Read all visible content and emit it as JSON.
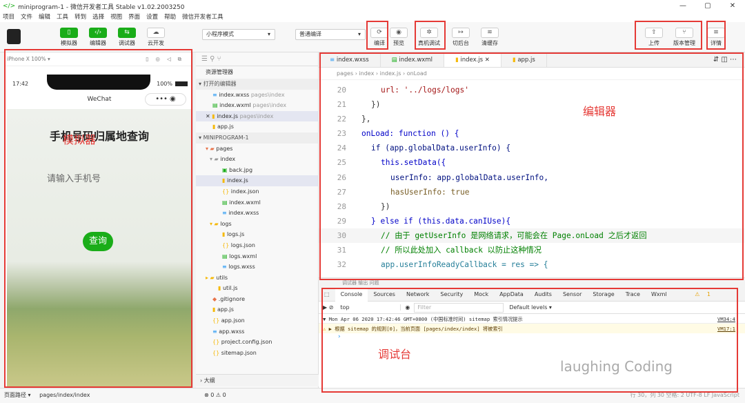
{
  "title": "miniprogram-1 - 微信开发者工具 Stable v1.02.2003250",
  "window_controls": [
    "—",
    "▢",
    "✕"
  ],
  "menu": [
    "项目",
    "文件",
    "编辑",
    "工具",
    "转到",
    "选择",
    "视图",
    "界面",
    "设置",
    "帮助",
    "微信开发者工具"
  ],
  "toolbar": {
    "simulator": "模拟器",
    "editor": "编辑器",
    "debugger": "调试器",
    "cloud": "云开发",
    "mode": "小程序模式",
    "compile_mode": "普通编译",
    "compile": "编译",
    "preview": "预览",
    "real_debug": "真机调试",
    "background": "切后台",
    "clear_cache": "清缓存",
    "upload": "上传",
    "version": "版本管理",
    "details": "详情"
  },
  "annotations": {
    "simulator": "模拟器",
    "editor": "编辑器",
    "debugger": "调试台",
    "watermark": "laughing Coding"
  },
  "sim": {
    "device": "iPhone X 100% ▾",
    "time": "17:42",
    "battery": "100%",
    "nav_title": "WeChat",
    "app_title": "手机号码归属地查询",
    "placeholder": "请输入手机号",
    "button": "查询"
  },
  "explorer": {
    "header": "资源管理器",
    "open_editors": "打开的编辑器",
    "project": "MINIPROGRAM-1",
    "outline": "大纲",
    "open_files": [
      {
        "name": "index.wxss",
        "path": "pages\\index"
      },
      {
        "name": "index.wxml",
        "path": "pages\\index"
      },
      {
        "name": "index.js",
        "path": "pages\\index"
      },
      {
        "name": "app.js",
        "path": ""
      }
    ],
    "tree": [
      "pages",
      "index",
      "back.jpg",
      "index.js",
      "index.json",
      "index.wxml",
      "index.wxss",
      "logs",
      "logs.js",
      "logs.json",
      "logs.wxml",
      "logs.wxss",
      "utils",
      "util.js",
      ".gitignore",
      "app.js",
      "app.json",
      "app.wxss",
      "project.config.json",
      "sitemap.json"
    ]
  },
  "editor": {
    "tabs": [
      "index.wxss",
      "index.wxml",
      "index.js",
      "app.js"
    ],
    "breadcrumb": "pages › index › index.js › onLoad",
    "lines": [
      "20",
      "21",
      "22",
      "23",
      "24",
      "25",
      "26",
      "27",
      "28",
      "29",
      "30",
      "31",
      "32"
    ],
    "code": [
      "url: '../logs/logs'",
      "})",
      "},",
      "onLoad: function () {",
      "if (app.globalData.userInfo) {",
      "this.setData({",
      "userInfo: app.globalData.userInfo,",
      "hasUserInfo: true",
      "})",
      "} else if (this.data.canIUse){",
      "// 由于 getUserInfo 是网络请求，可能会在 Page.onLoad 之后才返回",
      "// 所以此处加入 callback 以防止这种情况",
      "app.userInfoReadyCallback = res => {"
    ]
  },
  "debug": {
    "top_tabs": "调试器   输出   问题",
    "tabs": [
      "Console",
      "Sources",
      "Network",
      "Security",
      "Mock",
      "AppData",
      "Audits",
      "Sensor",
      "Storage",
      "Trace",
      "Wxml"
    ],
    "context": "top",
    "filter_placeholder": "Filter",
    "levels": "Default levels ▾",
    "warn_count": "1",
    "log1": "▼ Mon Apr 06 2020 17:42:46 GMT+0800 (中国标准时间) sitemap 索引情况提示",
    "log1_src": "VM34:4",
    "log2": "▶ 根据 sitemap 的规则[0]，当前页面 [pages/index/index] 将被索引",
    "log2_src": "VM17:1"
  },
  "status": {
    "path_label": "页面路径 ▾",
    "path": "pages/index/index",
    "errors": "⊗ 0 ⚠ 0",
    "right": "行 30，列 30   空格: 2   UTF-8   LF   JavaScript"
  }
}
